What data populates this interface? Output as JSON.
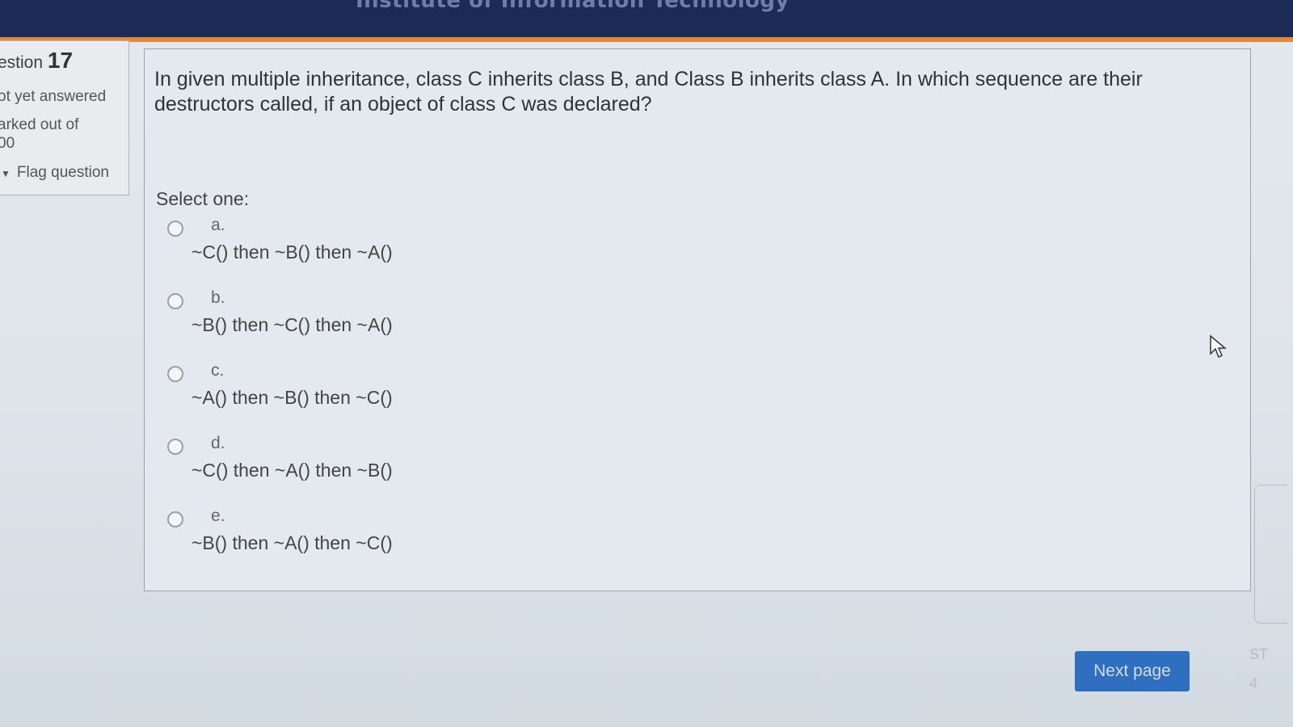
{
  "header": {
    "title": "Institute of Information Technology"
  },
  "question_info": {
    "label": "estion",
    "number": "17",
    "state": "ot yet answered",
    "grade_line1": "arked out of",
    "grade_line2": "00",
    "flag_label": "Flag question"
  },
  "question": {
    "text": "In given multiple inheritance, class C inherits class B, and Class B inherits class A. In which sequence are their destructors called, if an object of class C was declared?",
    "prompt": "Select one:",
    "options": [
      {
        "letter": "a.",
        "text": "~C() then ~B() then ~A()"
      },
      {
        "letter": "b.",
        "text": "~B() then ~C() then ~A()"
      },
      {
        "letter": "c.",
        "text": "~A() then ~B() then ~C()"
      },
      {
        "letter": "d.",
        "text": "~C() then ~A() then ~B()"
      },
      {
        "letter": "e.",
        "text": "~B() then ~A() then ~C()"
      }
    ]
  },
  "navigation": {
    "next_label": "Next page"
  },
  "edge_text": {
    "line1": "ST",
    "line2": "4"
  }
}
